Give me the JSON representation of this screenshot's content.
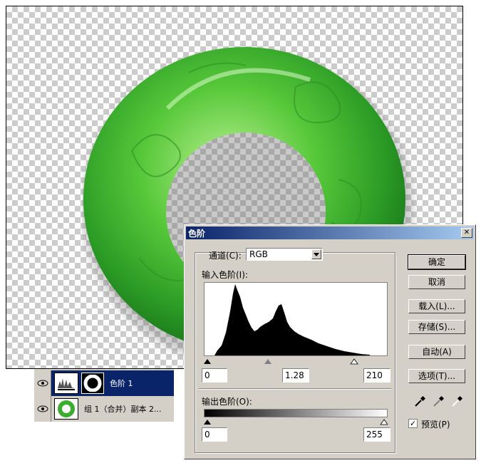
{
  "layers": [
    {
      "name": "色阶 1",
      "selected": true,
      "thumb": "levels-adjustment-icon",
      "mask": "ring-mask-icon"
    },
    {
      "name": "组 1（合并）副本 2...",
      "selected": false,
      "thumb": "jade-ring-thumbnail"
    }
  ],
  "dialog": {
    "title": "色阶",
    "close_label": "✕",
    "channel_label": "通道(C):",
    "channel_value": "RGB",
    "input_levels_label": "输入色阶(I):",
    "input_black": "0",
    "input_gamma": "1.28",
    "input_white": "210",
    "output_levels_label": "输出色阶(O):",
    "output_black": "0",
    "output_white": "255",
    "buttons": {
      "ok": "确定",
      "cancel": "取消",
      "load": "载入(L)...",
      "save": "存储(S)...",
      "auto": "自动(A)",
      "options": "选项(T)..."
    },
    "preview_label": "预览(P)",
    "preview_checked": "✓"
  },
  "colors": {
    "title_start": "#0a246a",
    "title_end": "#a6caf0",
    "jade_dark": "#1f8a1f",
    "jade_light": "#8ee36a",
    "dialog_bg": "#d4d0c8"
  }
}
